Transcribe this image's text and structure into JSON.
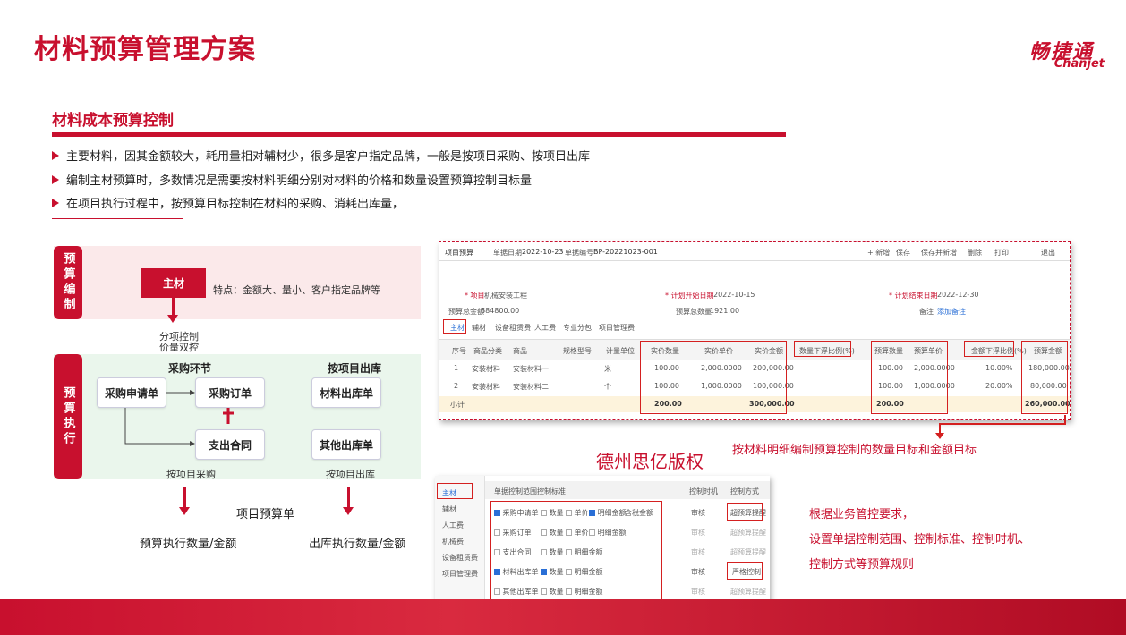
{
  "page_title": "材料预算管理方案",
  "logo": {
    "cn": "畅捷通",
    "en": "Chanjet"
  },
  "section_title": "材料成本预算控制",
  "bullets": [
    "主要材料，因其金额较大，耗用量相对辅材少，很多是客户指定品牌，一般是按项目采购、按项目出库",
    "编制主材预算时，多数情况是需要按材料明细分别对材料的价格和数量设置预算控制目标量",
    "在项目执行过程中，按预算目标控制在材料的采购、消耗出库量，"
  ],
  "diagram": {
    "label_budget_compile": "预算编制",
    "label_budget_exec": "预算执行",
    "main_material": "主材",
    "features": "特点：金额大、量小、客户指定品牌等",
    "split_control": [
      "分项控制",
      "价量双控"
    ],
    "purchase_stage": "采购环节",
    "project_outbound": "按项目出库",
    "purchase_request": "采购申请单",
    "purchase_order": "采购订单",
    "expense_contract": "支出合同",
    "material_outbound": "材料出库单",
    "other_outbound": "其他出库单",
    "by_project_purchase": "按项目采购",
    "by_project_out": "按项目出库",
    "project_budget": "项目预算单",
    "exec_qty_amount": "预算执行数量/金额",
    "out_qty_amount": "出库执行数量/金额"
  },
  "shot1": {
    "tab": "项目预算",
    "doc_date_label": "单据日期",
    "doc_date": "2022-10-23",
    "doc_no_label": "单据编号",
    "doc_no": "BP-20221023-001",
    "toolbar": [
      "+ 新增",
      "保存",
      "保存并新增",
      "删除",
      "打印",
      "退出"
    ],
    "project_label": "* 项目",
    "project": "机械安装工程",
    "plan_start_label": "* 计划开始日期",
    "plan_start": "2022-10-15",
    "plan_end_label": "* 计划结束日期",
    "plan_end": "2022-12-30",
    "total_amount_label": "预算总金额",
    "total_amount": "684800.00",
    "total_qty_label": "预算总数量",
    "total_qty": "1921.00",
    "remark_label": "备注",
    "add_remark": "添加备注",
    "subtabs": [
      "主材",
      "辅材",
      "设备租赁费",
      "人工费",
      "专业分包",
      "项目管理费"
    ],
    "headers": [
      "序号",
      "商品分类",
      "商品",
      "规格型号",
      "计量单位",
      "实价数量",
      "实价单价",
      "实价金额",
      "数量下浮比例(%)",
      "",
      "预算数量",
      "预算单价",
      "金额下浮比例(%)",
      "",
      "预算金额"
    ],
    "rows": [
      [
        "1",
        "安装材料",
        "安装材料一",
        "",
        "米",
        "100.00",
        "2,000.0000",
        "200,000.00",
        "",
        "",
        "100.00",
        "2,000.0000",
        "10.00%",
        "",
        "180,000.00"
      ],
      [
        "2",
        "安装材料",
        "安装材料二",
        "",
        "个",
        "100.00",
        "1,000.0000",
        "100,000.00",
        "",
        "",
        "100.00",
        "1,000.0000",
        "20.00%",
        "",
        "80,000.00"
      ]
    ],
    "subtotal": [
      "小计",
      "200.00",
      "300,000.00",
      "200.00",
      "260,000.00"
    ]
  },
  "copyright": "德州思亿版权",
  "caption1": "按材料明细编制预算控制的数量目标和金额目标",
  "shot2": {
    "left_items": [
      "主材",
      "辅材",
      "人工费",
      "机械费",
      "设备租赁费",
      "项目管理费"
    ],
    "headers": [
      "单据控制范围",
      "控制标准",
      "控制时机",
      "控制方式"
    ],
    "rows": [
      {
        "doc": "采购申请单",
        "doc_checked": true,
        "qty": "数量",
        "qty_checked": false,
        "price": "单价",
        "price_checked": false,
        "amt": "明细金额",
        "amt_checked": true,
        "extra": "含税金额",
        "timing": "审核",
        "mode": "超预算提醒"
      },
      {
        "doc": "采购订单",
        "doc_checked": false,
        "qty": "数量",
        "qty_checked": false,
        "price": "单价",
        "price_checked": false,
        "amt": "明细金额",
        "amt_checked": false,
        "extra": "",
        "timing": "审核",
        "mode": "超预算提醒"
      },
      {
        "doc": "支出合同",
        "doc_checked": false,
        "qty": "数量",
        "qty_checked": false,
        "price": "",
        "price_checked": false,
        "amt": "明细金额",
        "amt_checked": false,
        "extra": "",
        "timing": "审核",
        "mode": "超预算提醒"
      },
      {
        "doc": "材料出库单",
        "doc_checked": true,
        "qty": "数量",
        "qty_checked": true,
        "price": "",
        "price_checked": false,
        "amt": "明细金额",
        "amt_checked": false,
        "extra": "",
        "timing": "审核",
        "mode": "严格控制"
      },
      {
        "doc": "其他出库单",
        "doc_checked": false,
        "qty": "数量",
        "qty_checked": false,
        "price": "",
        "price_checked": false,
        "amt": "明细金额",
        "amt_checked": false,
        "extra": "",
        "timing": "审核",
        "mode": "超预算提醒"
      }
    ]
  },
  "caption2": [
    "根据业务管控要求，",
    "设置单据控制范围、控制标准、控制时机、",
    "控制方式等预算规则"
  ],
  "colors": {
    "brand": "#c8102e",
    "pink_band": "#fbe9ea",
    "green_band": "#eaf6ec"
  }
}
